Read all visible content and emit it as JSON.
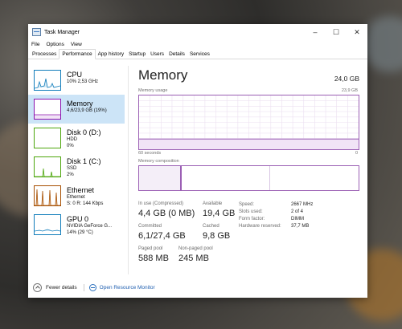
{
  "window": {
    "title": "Task Manager",
    "controls": [
      "–",
      "☐",
      "✕"
    ]
  },
  "menu": [
    "File",
    "Options",
    "View"
  ],
  "tabs": [
    "Processes",
    "Performance",
    "App history",
    "Startup",
    "Users",
    "Details",
    "Services"
  ],
  "active_tab": "Performance",
  "sidebar": {
    "items": [
      {
        "name": "CPU",
        "sub1": "10% 2,53 GHz",
        "sub2": "",
        "sub3": "",
        "color": "#117dbb"
      },
      {
        "name": "Memory",
        "sub1": "4,6/23,9 GB (19%)",
        "sub2": "",
        "sub3": "",
        "color": "#8b12ae"
      },
      {
        "name": "Disk 0 (D:)",
        "sub1": "HDD",
        "sub2": "0%",
        "sub3": "",
        "color": "#4da60c"
      },
      {
        "name": "Disk 1 (C:)",
        "sub1": "SSD",
        "sub2": "2%",
        "sub3": "",
        "color": "#4da60c"
      },
      {
        "name": "Ethernet",
        "sub1": "Ethernet",
        "sub2": "S: 0 R: 144 Kbps",
        "sub3": "",
        "color": "#a74f01"
      },
      {
        "name": "GPU 0",
        "sub1": "NVIDIA GeForce G...",
        "sub2": "14% (29 °C)",
        "sub3": "",
        "color": "#117dbb"
      }
    ]
  },
  "main": {
    "title": "Memory",
    "total": "24,0 GB",
    "memory_usage_label": "Memory usage",
    "memory_usage_max": "23,9 GB",
    "axis_left": "60 seconds",
    "axis_right": "0",
    "composition_label": "Memory composition",
    "usage_fraction": 0.19,
    "stats": {
      "in_use_label": "In use (Compressed)",
      "in_use_value": "4,4 GB (0 MB)",
      "available_label": "Available",
      "available_value": "19,4 GB",
      "committed_label": "Committed",
      "committed_value": "6,1/27,4 GB",
      "cached_label": "Cached",
      "cached_value": "9,8 GB",
      "paged_label": "Paged pool",
      "paged_value": "588 MB",
      "nonpaged_label": "Non-paged pool",
      "nonpaged_value": "245 MB"
    },
    "specs": {
      "speed_label": "Speed:",
      "speed_value": "2667 MHz",
      "slots_label": "Slots used:",
      "slots_value": "2 of 4",
      "form_label": "Form factor:",
      "form_value": "DIMM",
      "reserved_label": "Hardware reserved:",
      "reserved_value": "37,7 MB"
    }
  },
  "footer": {
    "fewer_details": "Fewer details",
    "resource_monitor": "Open Resource Monitor"
  },
  "colors": {
    "memory_accent": "#9b5fb4",
    "memory_fill": "#f4eef8",
    "selection": "#cce4f7"
  }
}
